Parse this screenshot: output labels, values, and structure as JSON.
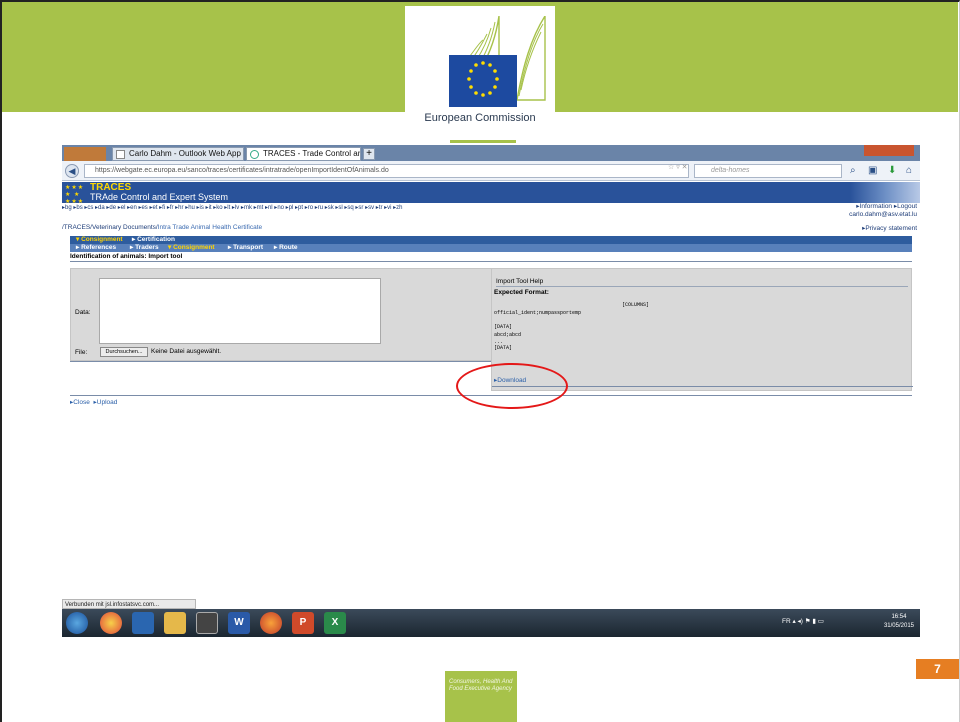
{
  "slide": {
    "org_name": "European Commission",
    "page_number": "7",
    "agency": "Consumers, Health And Food Executive Agency",
    "colors": {
      "green": "#a7c24a",
      "orange": "#e67e22",
      "eu_blue": "#1d4aa0"
    }
  },
  "browser": {
    "tabs": [
      {
        "label": "Carlo Dahm - Outlook Web App",
        "icon": "outlook-icon"
      },
      {
        "label": "TRACES - Trade Control and Expert S...",
        "icon": "loading-icon"
      }
    ],
    "new_tab": "+",
    "url": "https://webgate.ec.europa.eu/sanco/traces/certificates/intratrade/openImportIdentOfAnimals.do",
    "search_placeholder": "delta-homes"
  },
  "traces": {
    "title": "TRACES",
    "subtitle": "TRAde Control and Expert System",
    "languages": "▸bg ▸bs ▸cs ▸da ▸de ▸el ▸en ▸es ▸et ▸fi ▸fr ▸hr ▸hu ▸is ▸it ▸ko ▸lt ▸lv ▸mk ▸mt ▸nl ▸no ▸pl ▸pt ▸ro ▸ru ▸sk ▸sl ▸sq ▸sr ▸sv ▸tr ▸vi ▸zh",
    "info_links": "▸Information ▸Logout",
    "user_email": "carlo.dahm@asv.etat.lu",
    "breadcrumb_root": "/TRACES/Veterinary Documents/",
    "breadcrumb_current": "Intra Trade Animal Health Certificate",
    "privacy": "▸Privacy statement",
    "menu1": [
      "▾ Consignment",
      "▸ Certification"
    ],
    "menu2": [
      "▸ References",
      "▸ Traders",
      "▾ Consignment",
      "▸ Transport",
      "▸ Route"
    ],
    "page_title": "Identification of animals: Import tool",
    "form": {
      "data_label": "Data:",
      "file_label": "File:",
      "browse_button": "Durchsuchen...",
      "no_file": "Keine Datei ausgewählt."
    },
    "help": {
      "title": "Import Tool Help",
      "expected_format": "Expected Format:",
      "columns_tag": "[COLUMNS]",
      "columns": "official_ident;numpassportemp",
      "data_tag": "[DATA]",
      "sample_row": "abcd;abcd",
      "ellipsis": "...",
      "data_end_tag": "[DATA]",
      "download": "▸Download"
    },
    "footer_close": "▸Close",
    "footer_upload": "▸Upload"
  },
  "os": {
    "status_text": "Verbunden mit jsl.infostatsvc.com...",
    "language": "FR",
    "time": "16:54",
    "date": "31/05/2015"
  }
}
